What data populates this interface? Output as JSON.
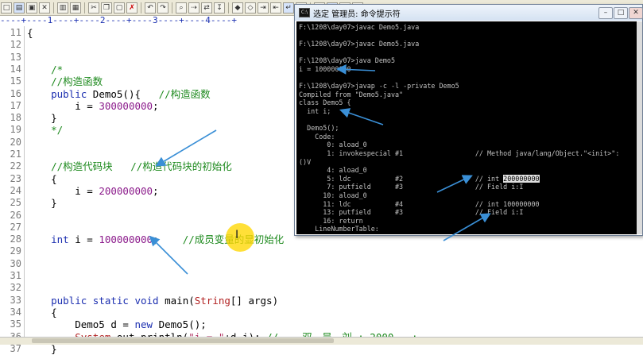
{
  "editor": {
    "ruler": "----+----1----+----2----+----3----+----4----+",
    "lines": [
      {
        "n": "11",
        "text": "{"
      },
      {
        "n": "12",
        "text": ""
      },
      {
        "n": "13",
        "text": ""
      },
      {
        "n": "14",
        "text": "    /*"
      },
      {
        "n": "15",
        "text": "    //构造函数"
      },
      {
        "n": "16",
        "text": "    public Demo5(){   //构造函数"
      },
      {
        "n": "17",
        "text": "        i = 300000000;"
      },
      {
        "n": "18",
        "text": "    }"
      },
      {
        "n": "19",
        "text": "    */"
      },
      {
        "n": "20",
        "text": ""
      },
      {
        "n": "21",
        "text": ""
      },
      {
        "n": "22",
        "text": "    //构造代码块   //构造代码块的初始化"
      },
      {
        "n": "23",
        "text": "    {"
      },
      {
        "n": "24",
        "text": "        i = 200000000;"
      },
      {
        "n": "25",
        "text": "    }"
      },
      {
        "n": "26",
        "text": ""
      },
      {
        "n": "27",
        "text": ""
      },
      {
        "n": "28",
        "text": "    int i = 100000000;    //成员变量的显初始化"
      },
      {
        "n": "29",
        "text": ""
      },
      {
        "n": "30",
        "text": ""
      },
      {
        "n": "31",
        "text": ""
      },
      {
        "n": "32",
        "text": ""
      },
      {
        "n": "33",
        "text": "    public static void main(String[] args)"
      },
      {
        "n": "34",
        "text": "    {"
      },
      {
        "n": "35",
        "text": "        Demo5 d = new Demo5();"
      },
      {
        "n": "36",
        "text": "        System.out.println(\"i = \"+d.i); //    双、吴、刘 : 2000   :"
      },
      {
        "n": "37",
        "text": "    }"
      }
    ]
  },
  "console": {
    "title": "选定 管理员: 命令提示符",
    "lines": [
      "F:\\1208\\day07>javac Demo5.java",
      "",
      "F:\\1208\\day07>javac Demo5.java",
      "",
      "F:\\1208\\day07>java Demo5",
      "i = 100000000",
      "",
      "F:\\1208\\day07>javap -c -l -private Demo5",
      "Compiled from \"Demo5.java\"",
      "class Demo5 {",
      "  int i;",
      "",
      "  Demo5();",
      "    Code:",
      "       0: aload_0",
      "       1: invokespecial #1                  // Method java/lang/Object.\"<init>\":",
      "()V",
      "       4: aload_0",
      "       5: ldc           #2                  // int ",
      "       7: putfield      #3                  // Field i:I",
      "      10: aload_0",
      "      11: ldc           #4                  // int 100000000",
      "      13: putfield      #3                  // Field i:I",
      "      16: return",
      "    LineNumberTable:"
    ],
    "highlight": "200000000",
    "colors": {
      "bg": "#000000",
      "fg": "#c0c0c0"
    }
  },
  "annotations": {
    "arrow_color": "#3a8fd6",
    "cursor_color": "#ffd700"
  }
}
